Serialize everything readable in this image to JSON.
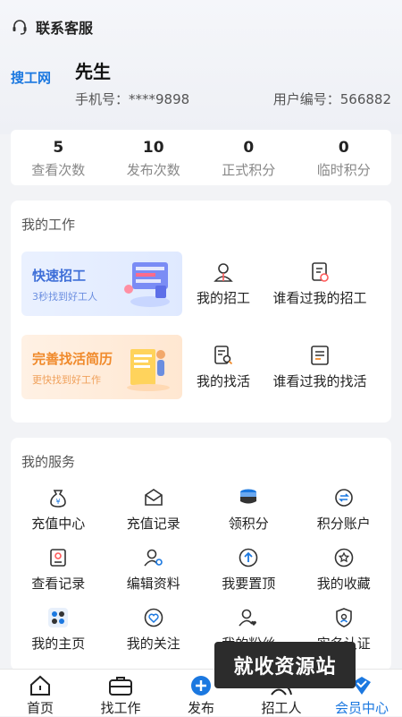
{
  "header": {
    "support_label": "联系客服",
    "support_icon": "headset-icon"
  },
  "profile": {
    "logo_text": "搜工网",
    "name": "先生",
    "phone": "手机号：****9898",
    "user_id": "用户编号：566882"
  },
  "stats": [
    {
      "value": "5",
      "label": "查看次数"
    },
    {
      "value": "10",
      "label": "发布次数"
    },
    {
      "value": "0",
      "label": "正式积分"
    },
    {
      "value": "0",
      "label": "临时积分"
    }
  ],
  "work": {
    "title": "我的工作",
    "promo_recruit": {
      "title": "快速招工",
      "subtitle": "3秒找到好工人"
    },
    "promo_resume": {
      "title": "完善找活简历",
      "subtitle": "更快找到好工作"
    },
    "items": [
      {
        "label": "我的招工",
        "icon": "worker-icon"
      },
      {
        "label": "谁看过我的招工",
        "icon": "doc-view-icon"
      },
      {
        "label": "我的找活",
        "icon": "doc-search-icon"
      },
      {
        "label": "谁看过我的找活",
        "icon": "list-doc-icon"
      }
    ]
  },
  "services": {
    "title": "我的服务",
    "items": [
      {
        "label": "充值中心",
        "icon": "money-bag-icon"
      },
      {
        "label": "充值记录",
        "icon": "envelope-icon"
      },
      {
        "label": "领积分",
        "icon": "coins-icon"
      },
      {
        "label": "积分账户",
        "icon": "account-icon"
      },
      {
        "label": "查看记录",
        "icon": "record-icon"
      },
      {
        "label": "编辑资料",
        "icon": "edit-profile-icon"
      },
      {
        "label": "我要置顶",
        "icon": "upload-top-icon"
      },
      {
        "label": "我的收藏",
        "icon": "favorite-icon"
      },
      {
        "label": "我的主页",
        "icon": "home-grid-icon"
      },
      {
        "label": "我的关注",
        "icon": "heart-icon"
      },
      {
        "label": "我的粉丝",
        "icon": "fans-icon"
      },
      {
        "label": "实名认证",
        "icon": "shield-icon"
      }
    ]
  },
  "watermark": "就收资源站",
  "tabbar": [
    {
      "label": "首页",
      "icon": "home-icon"
    },
    {
      "label": "找工作",
      "icon": "briefcase-icon"
    },
    {
      "label": "发布",
      "icon": "plus-icon"
    },
    {
      "label": "招工人",
      "icon": "people-icon"
    },
    {
      "label": "会员中心",
      "icon": "member-icon"
    }
  ],
  "colors": {
    "accent": "#1b78e0",
    "orange": "#f08a2b",
    "background": "#f2f3f6"
  }
}
